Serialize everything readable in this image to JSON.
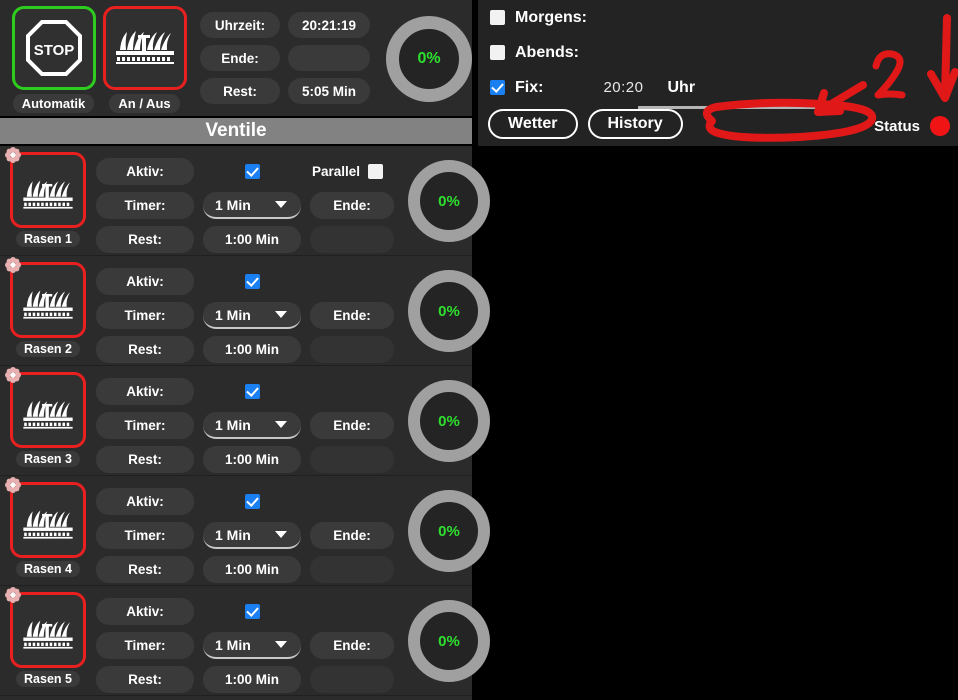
{
  "header": {
    "automatik": {
      "caption": "Automatik",
      "icon": "stop-octagon-icon",
      "border_color": "#2ecc1e"
    },
    "an_aus": {
      "caption": "An / Aus",
      "icon": "sprinkler-icon",
      "border_color": "#e82020"
    },
    "fields": [
      {
        "label": "Uhrzeit:",
        "value": "20:21:19"
      },
      {
        "label": "Ende:",
        "value": ""
      },
      {
        "label": "Rest:",
        "value": "5:05 Min"
      }
    ],
    "gauge": {
      "value": "0%",
      "color": "#2ee02e"
    }
  },
  "section_title": "Ventile",
  "valves": [
    {
      "name": "Rasen 1",
      "icon": "sprinkler-icon",
      "badge_icon": "flower-icon",
      "aktiv_label": "Aktiv:",
      "aktiv_checked": true,
      "parallel_label": "Parallel",
      "parallel_checked": false,
      "has_parallel": true,
      "timer_label": "Timer:",
      "timer_value": "1 Min",
      "ende_label": "Ende:",
      "ende_value": "",
      "rest_label": "Rest:",
      "rest_value": "1:00 Min",
      "gauge": "0%"
    },
    {
      "name": "Rasen 2",
      "icon": "sprinkler-icon",
      "badge_icon": "flower-icon",
      "aktiv_label": "Aktiv:",
      "aktiv_checked": true,
      "parallel_label": "",
      "parallel_checked": false,
      "has_parallel": false,
      "timer_label": "Timer:",
      "timer_value": "1 Min",
      "ende_label": "Ende:",
      "ende_value": "",
      "rest_label": "Rest:",
      "rest_value": "1:00 Min",
      "gauge": "0%"
    },
    {
      "name": "Rasen 3",
      "icon": "sprinkler-icon",
      "badge_icon": "flower-icon",
      "aktiv_label": "Aktiv:",
      "aktiv_checked": true,
      "parallel_label": "",
      "parallel_checked": false,
      "has_parallel": false,
      "timer_label": "Timer:",
      "timer_value": "1 Min",
      "ende_label": "Ende:",
      "ende_value": "",
      "rest_label": "Rest:",
      "rest_value": "1:00 Min",
      "gauge": "0%"
    },
    {
      "name": "Rasen 4",
      "icon": "sprinkler-icon",
      "badge_icon": "flower-icon",
      "aktiv_label": "Aktiv:",
      "aktiv_checked": true,
      "parallel_label": "",
      "parallel_checked": false,
      "has_parallel": false,
      "timer_label": "Timer:",
      "timer_value": "1 Min",
      "ende_label": "Ende:",
      "ende_value": "",
      "rest_label": "Rest:",
      "rest_value": "1:00 Min",
      "gauge": "0%"
    },
    {
      "name": "Rasen 5",
      "icon": "sprinkler-icon",
      "badge_icon": "flower-icon",
      "aktiv_label": "Aktiv:",
      "aktiv_checked": true,
      "parallel_label": "",
      "parallel_checked": false,
      "has_parallel": false,
      "timer_label": "Timer:",
      "timer_value": "1 Min",
      "ende_label": "Ende:",
      "ende_value": "",
      "rest_label": "Rest:",
      "rest_value": "1:00 Min",
      "gauge": "0%"
    }
  ],
  "schedule": {
    "morgens": {
      "label": "Morgens:",
      "checked": false
    },
    "abends": {
      "label": "Abends:",
      "checked": false
    },
    "fix": {
      "label": "Fix:",
      "checked": true,
      "time": "20:20",
      "unit": "Uhr"
    },
    "buttons": [
      {
        "label": "Wetter"
      },
      {
        "label": "History"
      }
    ],
    "status": {
      "label": "Status",
      "color": "#f01414"
    }
  },
  "annotations": {
    "digit": "2",
    "color": "#e01818",
    "marks": [
      "oval",
      "left-arrow",
      "digit-2",
      "down-arrow"
    ]
  }
}
